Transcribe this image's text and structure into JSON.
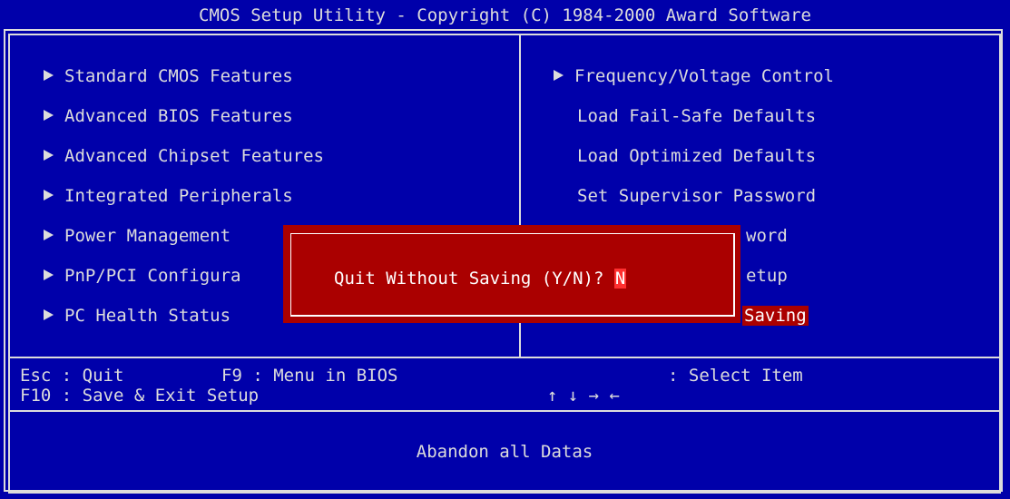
{
  "title": "CMOS Setup Utility - Copyright (C) 1984-2000 Award Software",
  "left_menu": [
    {
      "label": "Standard CMOS Features",
      "submenu": true
    },
    {
      "label": "Advanced BIOS Features",
      "submenu": true
    },
    {
      "label": "Advanced Chipset Features",
      "submenu": true
    },
    {
      "label": "Integrated Peripherals",
      "submenu": true
    },
    {
      "label": "Power Management",
      "submenu": true
    },
    {
      "label": "PnP/PCI Configura",
      "submenu": true
    },
    {
      "label": "PC Health Status",
      "submenu": true
    }
  ],
  "right_menu": [
    {
      "label": "Frequency/Voltage Control",
      "submenu": true
    },
    {
      "label": "Load Fail-Safe Defaults",
      "submenu": false
    },
    {
      "label": "Load Optimized Defaults",
      "submenu": false
    },
    {
      "label": "Set Supervisor Password",
      "submenu": false
    },
    {
      "label": "word",
      "submenu": false
    },
    {
      "label": "etup",
      "submenu": false
    },
    {
      "label": "Saving",
      "submenu": false,
      "selected": true
    }
  ],
  "dialog": {
    "prompt": "Quit Without Saving (Y/N)?",
    "input_value": "N"
  },
  "help": {
    "esc": "Esc : Quit",
    "f9": "F9 : Menu in BIOS",
    "f10": "F10 : Save & Exit Setup",
    "select_arrows": "↑ ↓ → ←",
    "select": ": Select Item"
  },
  "status": "Abandon all Datas",
  "colors": {
    "background": "#0000aa",
    "text": "#dcdcdc",
    "dialog": "#aa0000",
    "highlight": "#aa0000"
  }
}
